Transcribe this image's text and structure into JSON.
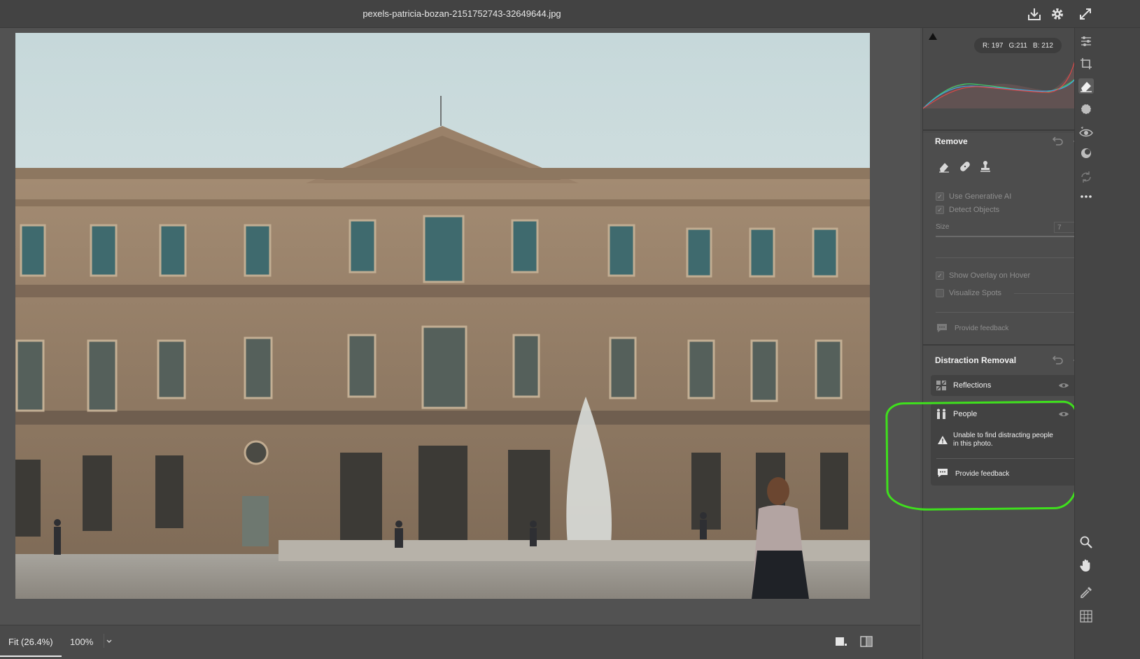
{
  "window": {
    "title": "pexels-patricia-bozan-2151752743-32649644.jpg"
  },
  "titlebar_icons": [
    "download-icon",
    "gear-icon",
    "expand-icon"
  ],
  "histogram": {
    "r_label": "R:",
    "r": "197",
    "g_label": "G:",
    "g": "211",
    "b_label": "B:",
    "b": "212"
  },
  "remove": {
    "title": "Remove",
    "use_generative_ai": "Use Generative AI",
    "use_generative_ai_checked": true,
    "detect_objects": "Detect Objects",
    "detect_objects_checked": true,
    "size_label": "Size",
    "size_value": "7",
    "show_overlay": "Show Overlay on Hover",
    "show_overlay_checked": true,
    "visualize_spots": "Visualize Spots",
    "visualize_spots_checked": false,
    "feedback": "Provide feedback"
  },
  "distraction": {
    "title": "Distraction Removal",
    "reflections_label": "Reflections",
    "people_label": "People",
    "people_warning_line1": "Unable to find distracting people",
    "people_warning_line2": "in this photo.",
    "feedback": "Provide feedback"
  },
  "bottom": {
    "fit_label": "Fit (26.4%)",
    "zoom_label": "100%"
  },
  "colors": {
    "annotation": "#3fe01d",
    "panel_bg": "#4d4d4d"
  }
}
